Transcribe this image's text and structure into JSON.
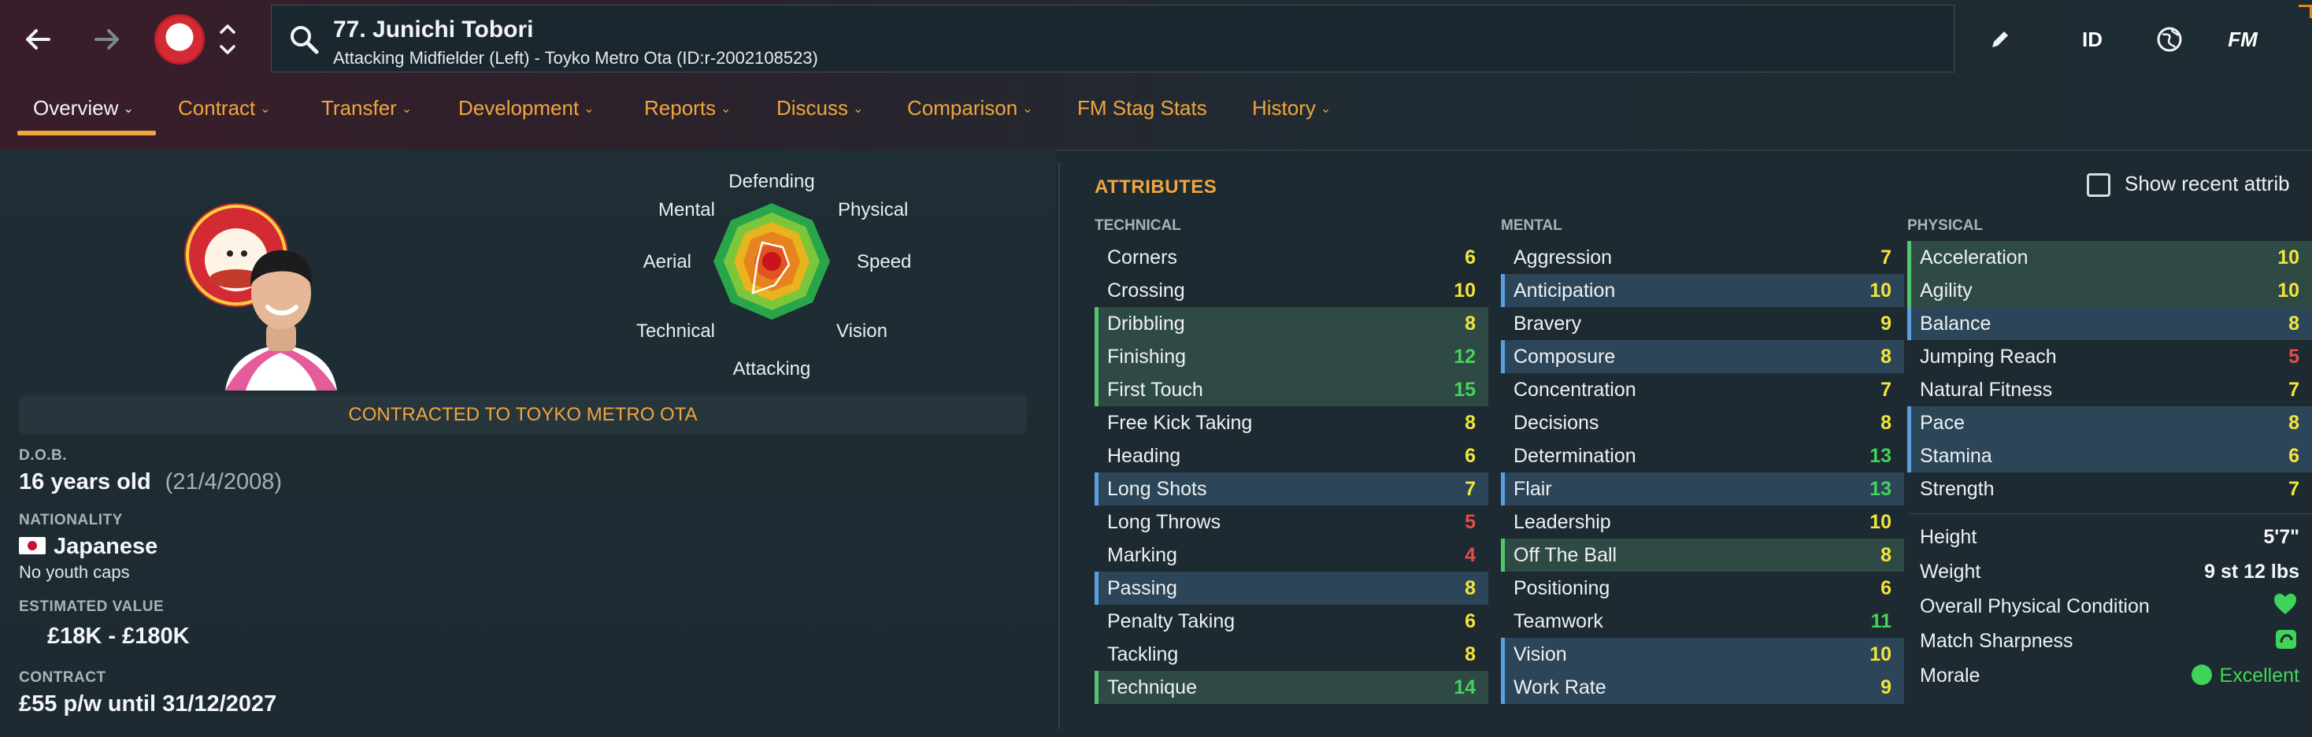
{
  "header": {
    "player_title": "77. Junichi Tobori",
    "player_subtitle": "Attacking Midfielder (Left) - Toyko Metro Ota (ID:r-2002108523)",
    "icons": {
      "back": "arrow-left-icon",
      "forward": "arrow-right-icon",
      "search": "search-icon",
      "edit": "pencil-icon",
      "id_label": "ID",
      "globe": "globe-icon",
      "fm_label": "FM"
    }
  },
  "tabs": [
    {
      "label": "Overview",
      "has_menu": true,
      "active": true
    },
    {
      "label": "Contract",
      "has_menu": true
    },
    {
      "label": "Transfer",
      "has_menu": true
    },
    {
      "label": "Development",
      "has_menu": true
    },
    {
      "label": "Reports",
      "has_menu": true
    },
    {
      "label": "Discuss",
      "has_menu": true
    },
    {
      "label": "Comparison",
      "has_menu": true
    },
    {
      "label": "FM Stag Stats",
      "has_menu": false
    },
    {
      "label": "History",
      "has_menu": true
    }
  ],
  "radar": {
    "labels": {
      "top": "Defending",
      "top_right": "Physical",
      "right": "Speed",
      "bottom_right": "Vision",
      "bottom": "Attacking",
      "bottom_left": "Technical",
      "left": "Aerial",
      "top_left": "Mental"
    }
  },
  "contract_banner": "CONTRACTED TO TOYKO METRO OTA",
  "details": {
    "dob_label": "D.O.B.",
    "age": "16 years old",
    "dob": "(21/4/2008)",
    "nationality_label": "NATIONALITY",
    "nationality": "Japanese",
    "youth_caps": "No youth caps",
    "value_label": "ESTIMATED VALUE",
    "value": "£18K - £180K",
    "contract_label": "CONTRACT",
    "contract": "£55 p/w until 31/12/2027"
  },
  "attributes": {
    "title": "ATTRIBUTES",
    "show_recent": "Show recent attrib",
    "technical_label": "TECHNICAL",
    "mental_label": "MENTAL",
    "physical_label": "PHYSICAL",
    "technical": [
      {
        "name": "Corners",
        "value": "6",
        "hl": ""
      },
      {
        "name": "Crossing",
        "value": "10",
        "hl": ""
      },
      {
        "name": "Dribbling",
        "value": "8",
        "hl": "green"
      },
      {
        "name": "Finishing",
        "value": "12",
        "hl": "green"
      },
      {
        "name": "First Touch",
        "value": "15",
        "hl": "green"
      },
      {
        "name": "Free Kick Taking",
        "value": "8",
        "hl": ""
      },
      {
        "name": "Heading",
        "value": "6",
        "hl": ""
      },
      {
        "name": "Long Shots",
        "value": "7",
        "hl": "blue"
      },
      {
        "name": "Long Throws",
        "value": "5",
        "hl": ""
      },
      {
        "name": "Marking",
        "value": "4",
        "hl": ""
      },
      {
        "name": "Passing",
        "value": "8",
        "hl": "blue"
      },
      {
        "name": "Penalty Taking",
        "value": "6",
        "hl": ""
      },
      {
        "name": "Tackling",
        "value": "8",
        "hl": ""
      },
      {
        "name": "Technique",
        "value": "14",
        "hl": "green"
      }
    ],
    "mental": [
      {
        "name": "Aggression",
        "value": "7",
        "hl": ""
      },
      {
        "name": "Anticipation",
        "value": "10",
        "hl": "blue"
      },
      {
        "name": "Bravery",
        "value": "9",
        "hl": ""
      },
      {
        "name": "Composure",
        "value": "8",
        "hl": "blue"
      },
      {
        "name": "Concentration",
        "value": "7",
        "hl": ""
      },
      {
        "name": "Decisions",
        "value": "8",
        "hl": ""
      },
      {
        "name": "Determination",
        "value": "13",
        "hl": ""
      },
      {
        "name": "Flair",
        "value": "13",
        "hl": "blue"
      },
      {
        "name": "Leadership",
        "value": "10",
        "hl": ""
      },
      {
        "name": "Off The Ball",
        "value": "8",
        "hl": "green"
      },
      {
        "name": "Positioning",
        "value": "6",
        "hl": ""
      },
      {
        "name": "Teamwork",
        "value": "11",
        "hl": ""
      },
      {
        "name": "Vision",
        "value": "10",
        "hl": "blue"
      },
      {
        "name": "Work Rate",
        "value": "9",
        "hl": "blue"
      }
    ],
    "physical": [
      {
        "name": "Acceleration",
        "value": "10",
        "hl": "green"
      },
      {
        "name": "Agility",
        "value": "10",
        "hl": "green"
      },
      {
        "name": "Balance",
        "value": "8",
        "hl": "blue"
      },
      {
        "name": "Jumping Reach",
        "value": "5",
        "hl": ""
      },
      {
        "name": "Natural Fitness",
        "value": "7",
        "hl": ""
      },
      {
        "name": "Pace",
        "value": "8",
        "hl": "blue"
      },
      {
        "name": "Stamina",
        "value": "6",
        "hl": "blue"
      },
      {
        "name": "Strength",
        "value": "7",
        "hl": ""
      }
    ],
    "info": [
      {
        "label": "Height",
        "value": "5'7\""
      },
      {
        "label": "Weight",
        "value": "9 st 12 lbs"
      },
      {
        "label": "Overall Physical Condition",
        "value": ""
      },
      {
        "label": "Match Sharpness",
        "value": ""
      },
      {
        "label": "Morale",
        "value": "Excellent"
      }
    ]
  },
  "colors": {
    "accent": "#f0a63b",
    "green": "#44d35c",
    "yellow": "#f2e53a",
    "red": "#ea4b47"
  }
}
